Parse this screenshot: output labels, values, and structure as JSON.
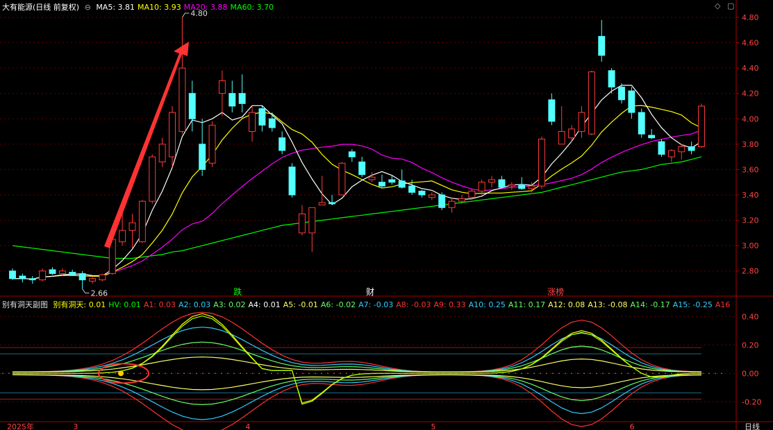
{
  "main_header": {
    "title": "大有能源(日线 前复权)",
    "toggle_icon": "collapse-circle-icon",
    "ma": [
      {
        "label": "MA5: 3.81",
        "color": "#ffffff"
      },
      {
        "label": "MA10: 3.93",
        "color": "#ffff00"
      },
      {
        "label": "MA20: 3.88",
        "color": "#ff00ff"
      },
      {
        "label": "MA60: 3.70",
        "color": "#00ff00"
      }
    ]
  },
  "window_controls": {
    "diamond": "◇",
    "close": "▢"
  },
  "sub_header": {
    "title": "别有洞天副图",
    "items": [
      {
        "label": "别有洞天: 0.01",
        "color": "#ffff00"
      },
      {
        "label": "HV: 0.01",
        "color": "#00ff00"
      },
      {
        "label": "A1: 0.03",
        "color": "#ff3333"
      },
      {
        "label": "A2: 0.03",
        "color": "#33ccff"
      },
      {
        "label": "A3: 0.02",
        "color": "#66ff66"
      },
      {
        "label": "A4: 0.01",
        "color": "#ffffff"
      },
      {
        "label": "A5: -0.01",
        "color": "#ffff66"
      },
      {
        "label": "A6: -0.02",
        "color": "#66ff66"
      },
      {
        "label": "A7: -0.03",
        "color": "#33ccff"
      },
      {
        "label": "A8: -0.03",
        "color": "#ff3333"
      },
      {
        "label": "A9: 0.33",
        "color": "#ff3333"
      },
      {
        "label": "A10: 0.25",
        "color": "#33ccff"
      },
      {
        "label": "A11: 0.17",
        "color": "#66ff66"
      },
      {
        "label": "A12: 0.08",
        "color": "#ffff66"
      },
      {
        "label": "A13: -0.08",
        "color": "#ffff66"
      },
      {
        "label": "A14: -0.17",
        "color": "#66ff66"
      },
      {
        "label": "A15: -0.25",
        "color": "#33ccff"
      },
      {
        "label": "A16",
        "color": "#ff3333"
      }
    ]
  },
  "chart_data": {
    "type": "candlestick",
    "price_axis_labels": [
      "4.80",
      "4.60",
      "4.40",
      "4.20",
      "4.00",
      "3.80",
      "3.60",
      "3.40",
      "3.20",
      "3.00",
      "2.80"
    ],
    "price_range": [
      2.66,
      4.8
    ],
    "indicator_axis_labels": [
      "0.40",
      "0.20",
      "0.00",
      "-0.20"
    ],
    "indicator_range": [
      -0.33,
      0.46
    ],
    "annotations": {
      "high": "4.80",
      "low": "2.66"
    },
    "markers": [
      {
        "label": "跌",
        "color": "#00ff00",
        "index": 17
      },
      {
        "label": "财",
        "color": "#ffffff",
        "index": 27
      },
      {
        "label": "涨榜",
        "color": "#ff4444",
        "index": 41
      }
    ],
    "date_labels": [
      {
        "label": "2025年",
        "index": 0
      },
      {
        "label": "3",
        "index": 5
      },
      {
        "label": "4",
        "index": 18
      },
      {
        "label": "5",
        "index": 32
      },
      {
        "label": "6",
        "index": 47
      }
    ],
    "period_label": "日线",
    "candles": [
      {
        "o": 2.8,
        "h": 2.82,
        "l": 2.73,
        "c": 2.74
      },
      {
        "o": 2.76,
        "h": 2.78,
        "l": 2.71,
        "c": 2.74
      },
      {
        "o": 2.74,
        "h": 2.76,
        "l": 2.7,
        "c": 2.73
      },
      {
        "o": 2.73,
        "h": 2.82,
        "l": 2.72,
        "c": 2.8
      },
      {
        "o": 2.81,
        "h": 2.83,
        "l": 2.77,
        "c": 2.78
      },
      {
        "o": 2.78,
        "h": 2.82,
        "l": 2.76,
        "c": 2.8
      },
      {
        "o": 2.79,
        "h": 2.81,
        "l": 2.76,
        "c": 2.77
      },
      {
        "o": 2.78,
        "h": 2.8,
        "l": 2.66,
        "c": 2.73
      },
      {
        "o": 2.72,
        "h": 2.75,
        "l": 2.7,
        "c": 2.74
      },
      {
        "o": 2.73,
        "h": 2.78,
        "l": 2.72,
        "c": 2.77
      },
      {
        "o": 2.78,
        "h": 3.06,
        "l": 2.77,
        "c": 3.05
      },
      {
        "o": 3.03,
        "h": 3.3,
        "l": 3.0,
        "c": 3.12
      },
      {
        "o": 3.12,
        "h": 3.25,
        "l": 2.98,
        "c": 3.18
      },
      {
        "o": 3.03,
        "h": 3.36,
        "l": 3.02,
        "c": 3.35
      },
      {
        "o": 3.35,
        "h": 3.72,
        "l": 3.33,
        "c": 3.7
      },
      {
        "o": 3.66,
        "h": 3.85,
        "l": 3.62,
        "c": 3.8
      },
      {
        "o": 3.7,
        "h": 4.1,
        "l": 3.62,
        "c": 4.05
      },
      {
        "o": 3.9,
        "h": 4.8,
        "l": 3.88,
        "c": 4.4
      },
      {
        "o": 4.2,
        "h": 4.3,
        "l": 3.9,
        "c": 4.0
      },
      {
        "o": 3.8,
        "h": 4.0,
        "l": 3.55,
        "c": 3.6
      },
      {
        "o": 3.65,
        "h": 3.98,
        "l": 3.62,
        "c": 3.95
      },
      {
        "o": 4.2,
        "h": 4.38,
        "l": 4.02,
        "c": 4.3
      },
      {
        "o": 4.2,
        "h": 4.3,
        "l": 4.05,
        "c": 4.1
      },
      {
        "o": 4.2,
        "h": 4.35,
        "l": 4.05,
        "c": 4.12
      },
      {
        "o": 3.9,
        "h": 4.1,
        "l": 3.82,
        "c": 4.05
      },
      {
        "o": 4.08,
        "h": 4.1,
        "l": 3.9,
        "c": 3.95
      },
      {
        "o": 4.0,
        "h": 4.05,
        "l": 3.9,
        "c": 3.93
      },
      {
        "o": 3.85,
        "h": 3.9,
        "l": 3.72,
        "c": 3.75
      },
      {
        "o": 3.62,
        "h": 3.65,
        "l": 3.38,
        "c": 3.4
      },
      {
        "o": 3.1,
        "h": 3.32,
        "l": 3.08,
        "c": 3.25
      },
      {
        "o": 3.1,
        "h": 3.3,
        "l": 2.95,
        "c": 3.3
      },
      {
        "o": 3.32,
        "h": 3.55,
        "l": 3.32,
        "c": 3.34
      },
      {
        "o": 3.34,
        "h": 3.4,
        "l": 3.32,
        "c": 3.33
      },
      {
        "o": 3.4,
        "h": 3.66,
        "l": 3.4,
        "c": 3.65
      },
      {
        "o": 3.74,
        "h": 3.76,
        "l": 3.66,
        "c": 3.7
      },
      {
        "o": 3.66,
        "h": 3.7,
        "l": 3.54,
        "c": 3.56
      },
      {
        "o": 3.52,
        "h": 3.58,
        "l": 3.5,
        "c": 3.54
      },
      {
        "o": 3.5,
        "h": 3.56,
        "l": 3.46,
        "c": 3.47
      },
      {
        "o": 3.52,
        "h": 3.55,
        "l": 3.48,
        "c": 3.5
      },
      {
        "o": 3.51,
        "h": 3.6,
        "l": 3.45,
        "c": 3.46
      },
      {
        "o": 3.47,
        "h": 3.52,
        "l": 3.4,
        "c": 3.42
      },
      {
        "o": 3.43,
        "h": 3.44,
        "l": 3.38,
        "c": 3.4
      },
      {
        "o": 3.38,
        "h": 3.42,
        "l": 3.36,
        "c": 3.4
      },
      {
        "o": 3.4,
        "h": 3.42,
        "l": 3.28,
        "c": 3.3
      },
      {
        "o": 3.3,
        "h": 3.38,
        "l": 3.26,
        "c": 3.35
      },
      {
        "o": 3.35,
        "h": 3.4,
        "l": 3.33,
        "c": 3.37
      },
      {
        "o": 3.38,
        "h": 3.45,
        "l": 3.36,
        "c": 3.43
      },
      {
        "o": 3.43,
        "h": 3.52,
        "l": 3.4,
        "c": 3.5
      },
      {
        "o": 3.5,
        "h": 3.55,
        "l": 3.46,
        "c": 3.52
      },
      {
        "o": 3.52,
        "h": 3.55,
        "l": 3.45,
        "c": 3.46
      },
      {
        "o": 3.47,
        "h": 3.5,
        "l": 3.44,
        "c": 3.48
      },
      {
        "o": 3.48,
        "h": 3.54,
        "l": 3.44,
        "c": 3.45
      },
      {
        "o": 3.45,
        "h": 3.5,
        "l": 3.42,
        "c": 3.47
      },
      {
        "o": 3.47,
        "h": 3.86,
        "l": 3.45,
        "c": 3.84
      },
      {
        "o": 4.15,
        "h": 4.2,
        "l": 3.95,
        "c": 3.98
      },
      {
        "o": 3.8,
        "h": 4.1,
        "l": 3.8,
        "c": 3.9
      },
      {
        "o": 3.85,
        "h": 3.95,
        "l": 3.82,
        "c": 3.92
      },
      {
        "o": 3.9,
        "h": 4.1,
        "l": 3.85,
        "c": 4.05
      },
      {
        "o": 3.88,
        "h": 4.38,
        "l": 3.87,
        "c": 4.37
      },
      {
        "o": 4.65,
        "h": 4.78,
        "l": 4.45,
        "c": 4.5
      },
      {
        "o": 4.38,
        "h": 4.4,
        "l": 4.2,
        "c": 4.25
      },
      {
        "o": 4.25,
        "h": 4.28,
        "l": 4.12,
        "c": 4.15
      },
      {
        "o": 4.22,
        "h": 4.25,
        "l": 4.0,
        "c": 4.05
      },
      {
        "o": 4.05,
        "h": 4.08,
        "l": 3.85,
        "c": 3.88
      },
      {
        "o": 3.87,
        "h": 3.92,
        "l": 3.84,
        "c": 3.85
      },
      {
        "o": 3.82,
        "h": 3.84,
        "l": 3.7,
        "c": 3.72
      },
      {
        "o": 3.7,
        "h": 3.76,
        "l": 3.66,
        "c": 3.75
      },
      {
        "o": 3.74,
        "h": 3.8,
        "l": 3.68,
        "c": 3.78
      },
      {
        "o": 3.78,
        "h": 3.82,
        "l": 3.72,
        "c": 3.75
      },
      {
        "o": 3.78,
        "h": 4.12,
        "l": 3.77,
        "c": 4.1
      }
    ],
    "series_colors": {
      "ma5": "#ffffff",
      "ma10": "#ffff00",
      "ma20": "#ff00ff",
      "ma60": "#00ff00"
    },
    "ma60": [
      3.0,
      2.99,
      2.98,
      2.97,
      2.96,
      2.95,
      2.94,
      2.93,
      2.92,
      2.91,
      2.9,
      2.9,
      2.9,
      2.91,
      2.92,
      2.93,
      2.95,
      2.96,
      2.98,
      3.0,
      3.02,
      3.04,
      3.06,
      3.08,
      3.1,
      3.12,
      3.14,
      3.16,
      3.17,
      3.18,
      3.19,
      3.2,
      3.21,
      3.22,
      3.23,
      3.24,
      3.25,
      3.26,
      3.27,
      3.28,
      3.29,
      3.3,
      3.31,
      3.32,
      3.33,
      3.34,
      3.35,
      3.36,
      3.37,
      3.38,
      3.39,
      3.4,
      3.41,
      3.42,
      3.44,
      3.46,
      3.48,
      3.5,
      3.52,
      3.54,
      3.56,
      3.58,
      3.59,
      3.6,
      3.62,
      3.64,
      3.65,
      3.66,
      3.68,
      3.7
    ]
  }
}
